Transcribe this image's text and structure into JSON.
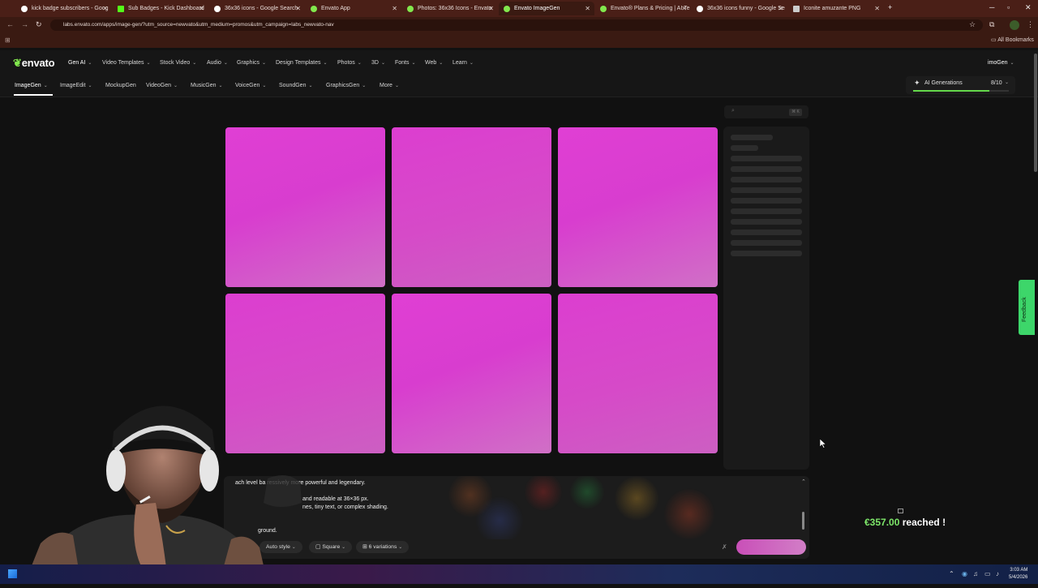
{
  "browser": {
    "tabs": [
      {
        "title": "kick badge subscribers - Goog",
        "color": "#ffffff"
      },
      {
        "title": "Sub Badges - Kick Dashboard",
        "color": "#53fc18"
      },
      {
        "title": "36x36 icons - Google Search",
        "color": "#ffffff"
      },
      {
        "title": "Envato App",
        "color": "#82e84d"
      },
      {
        "title": "Photos: 36x36 Icons - Envato",
        "color": "#82e84d"
      },
      {
        "title": "Envato ImageGen",
        "color": "#82e84d"
      },
      {
        "title": "Envato® Plans & Pricing | AI Te",
        "color": "#82e84d"
      },
      {
        "title": "36x36 icons funny - Google Se",
        "color": "#ffffff"
      },
      {
        "title": "Iconite amuzante PNG",
        "color": "#cccccc"
      }
    ],
    "url": "labs.envato.com/apps/image-gen/?utm_source=newvato&utm_medium=promos&utm_campaign=labs_newvato-nav",
    "all_bookmarks": "All Bookmarks"
  },
  "header": {
    "logo": "envato",
    "nav": [
      "Gen AI",
      "Video Templates",
      "Stock Video",
      "Audio",
      "Graphics",
      "Design Templates",
      "Photos",
      "3D",
      "Fonts",
      "Web",
      "Learn"
    ],
    "account": "imoGen",
    "subnav": [
      "ImageGen",
      "ImageEdit",
      "MockupGen",
      "VideoGen",
      "MusicGen",
      "VoiceGen",
      "SoundGen",
      "GraphicsGen",
      "More"
    ],
    "ai_generations": {
      "label": "AI Generations",
      "count": "8/10",
      "fraction": 0.8
    }
  },
  "search": {
    "shortcut": "⌘ K"
  },
  "prompt": {
    "line1": "ach level ba          ressively more powerful and legendary.",
    "line2": "and readable at 36×36 px.",
    "line3": "nes, tiny text, or complex shading.",
    "line4": "ground.",
    "style": "Auto style",
    "aspect": "Square",
    "variations": "6 variations"
  },
  "overlay": {
    "goal_amount": "€357.00",
    "goal_text": "reached !"
  },
  "feedback": "Feedback",
  "clock": {
    "time": "3:03 AM",
    "date": "5/4/2026"
  },
  "colors": {
    "accent": "#82e84d",
    "tile": "#d83dcf",
    "background": "#111111"
  }
}
